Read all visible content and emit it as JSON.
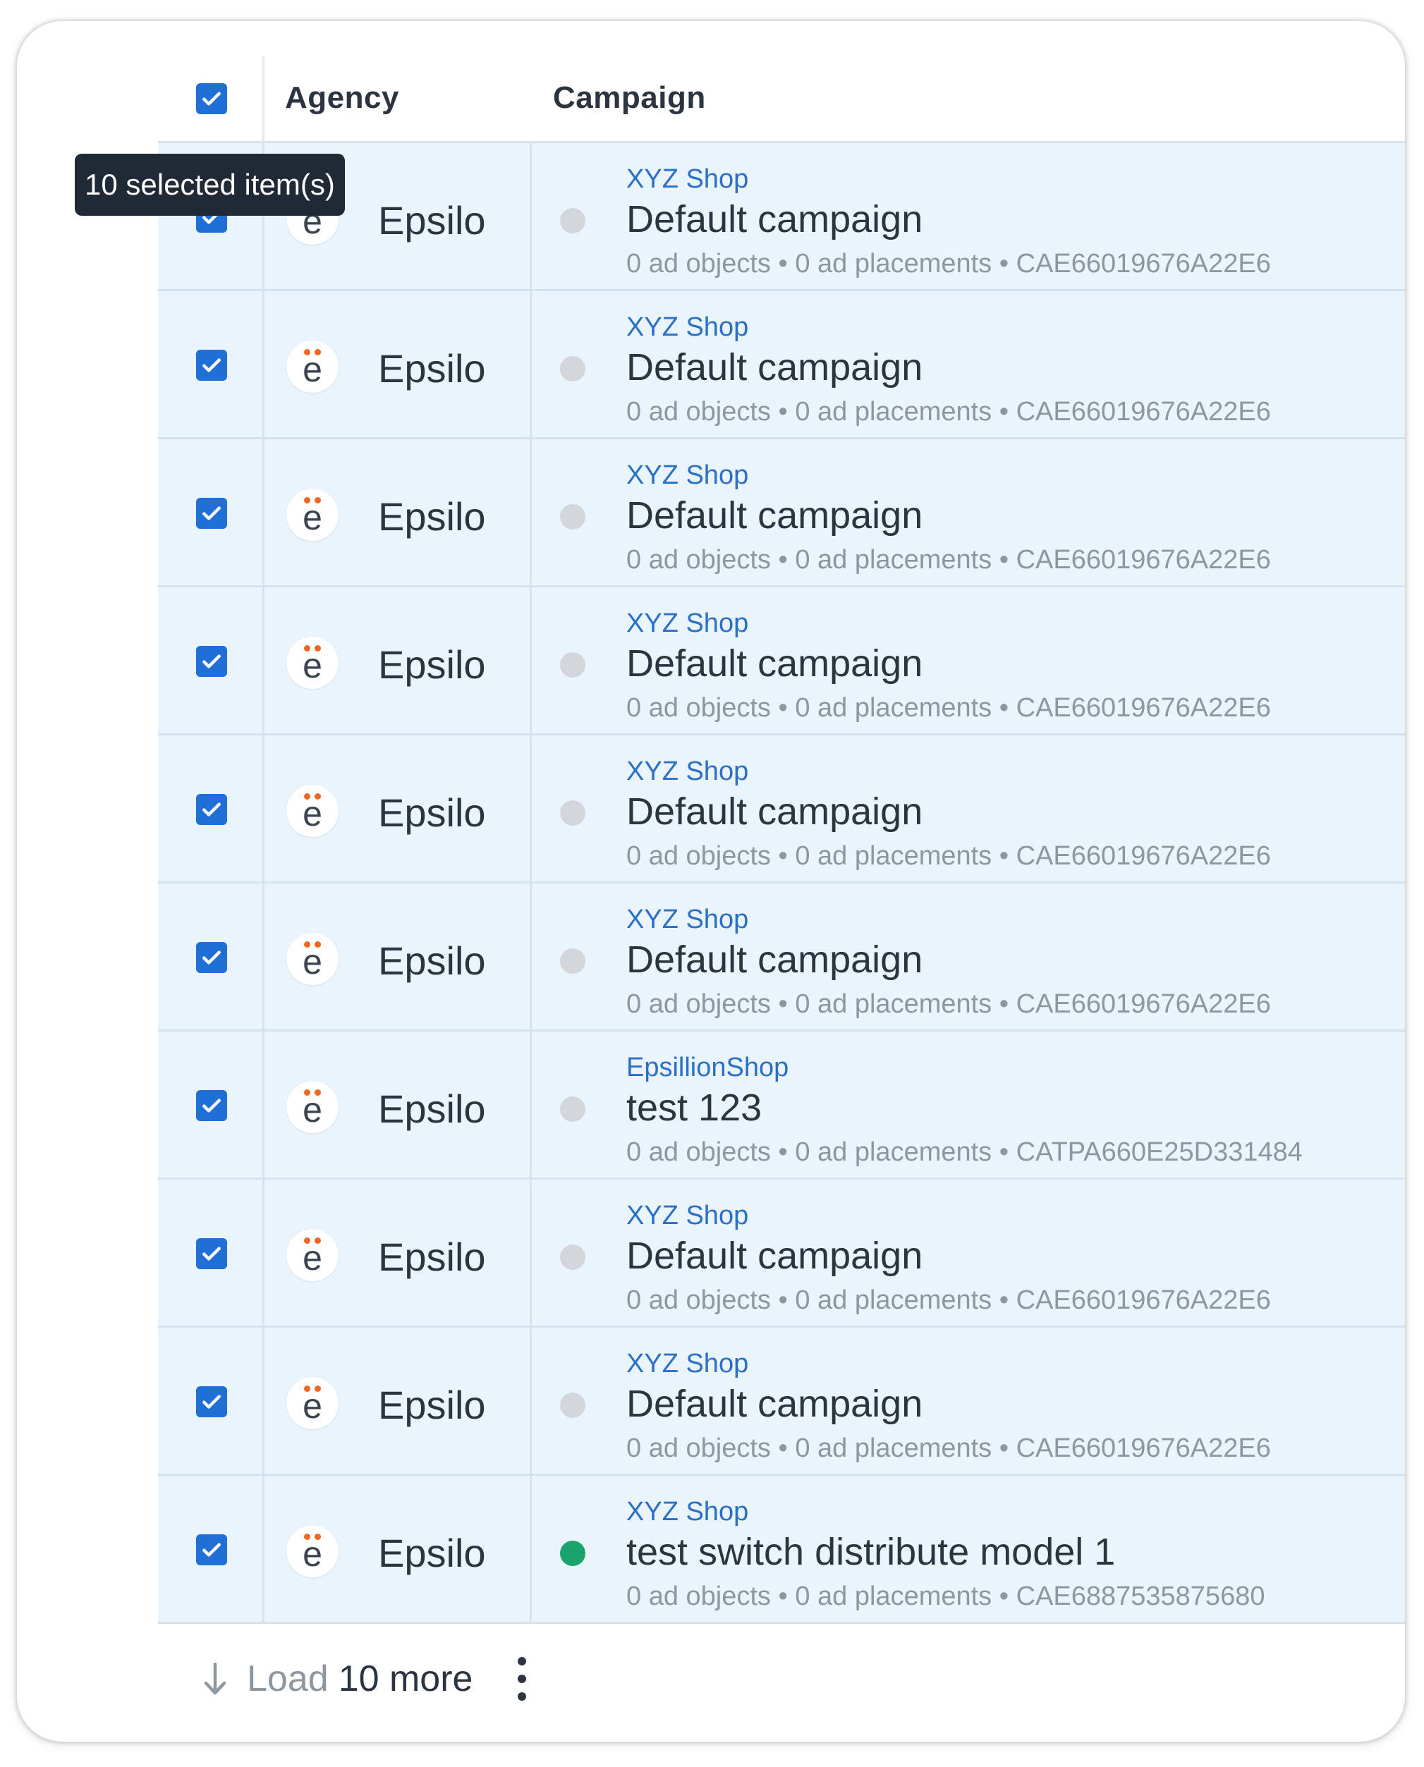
{
  "tooltip": "10 selected item(s)",
  "table": {
    "columns": [
      "Agency",
      "Campaign"
    ],
    "select_all_checked": true,
    "rows": [
      {
        "checked": true,
        "agency": "Epsilo",
        "agency_logo_icon": "epsilo-logo-icon",
        "shop": "XYZ Shop",
        "campaign": "Default campaign",
        "status": "inactive",
        "meta": "0 ad objects • 0 ad placements • CAE66019676A22E6"
      },
      {
        "checked": true,
        "agency": "Epsilo",
        "agency_logo_icon": "epsilo-logo-icon",
        "shop": "XYZ Shop",
        "campaign": "Default campaign",
        "status": "inactive",
        "meta": "0 ad objects • 0 ad placements • CAE66019676A22E6"
      },
      {
        "checked": true,
        "agency": "Epsilo",
        "agency_logo_icon": "epsilo-logo-icon",
        "shop": "XYZ Shop",
        "campaign": "Default campaign",
        "status": "inactive",
        "meta": "0 ad objects • 0 ad placements • CAE66019676A22E6"
      },
      {
        "checked": true,
        "agency": "Epsilo",
        "agency_logo_icon": "epsilo-logo-icon",
        "shop": "XYZ Shop",
        "campaign": "Default campaign",
        "status": "inactive",
        "meta": "0 ad objects • 0 ad placements • CAE66019676A22E6"
      },
      {
        "checked": true,
        "agency": "Epsilo",
        "agency_logo_icon": "epsilo-logo-icon",
        "shop": "XYZ Shop",
        "campaign": "Default campaign",
        "status": "inactive",
        "meta": "0 ad objects • 0 ad placements • CAE66019676A22E6"
      },
      {
        "checked": true,
        "agency": "Epsilo",
        "agency_logo_icon": "epsilo-logo-icon",
        "shop": "XYZ Shop",
        "campaign": "Default campaign",
        "status": "inactive",
        "meta": "0 ad objects • 0 ad placements • CAE66019676A22E6"
      },
      {
        "checked": true,
        "agency": "Epsilo",
        "agency_logo_icon": "epsilo-logo-icon",
        "shop": "EpsillionShop",
        "campaign": "test 123",
        "status": "inactive",
        "meta": "0 ad objects • 0 ad placements • CATPA660E25D331484"
      },
      {
        "checked": true,
        "agency": "Epsilo",
        "agency_logo_icon": "epsilo-logo-icon",
        "shop": "XYZ Shop",
        "campaign": "Default campaign",
        "status": "inactive",
        "meta": "0 ad objects • 0 ad placements • CAE66019676A22E6"
      },
      {
        "checked": true,
        "agency": "Epsilo",
        "agency_logo_icon": "epsilo-logo-icon",
        "shop": "XYZ Shop",
        "campaign": "Default campaign",
        "status": "inactive",
        "meta": "0 ad objects • 0 ad placements • CAE66019676A22E6"
      },
      {
        "checked": true,
        "agency": "Epsilo",
        "agency_logo_icon": "epsilo-logo-icon",
        "shop": "XYZ Shop",
        "campaign": "test switch distribute model 1",
        "status": "active",
        "meta": "0 ad objects • 0 ad placements • CAE6887535875680"
      }
    ]
  },
  "footer": {
    "load_label": "Load",
    "load_count": "10 more",
    "arrow_icon": "arrow-down-icon",
    "more_icon": "more-vertical-icon"
  },
  "colors": {
    "accent": "#1f6fd6",
    "shop_link": "#2a6fc9",
    "row_selected_bg": "#eaf4fd",
    "status_inactive": "#d3d6db",
    "status_active": "#1aa36b",
    "tooltip_bg": "#202a36",
    "logo_dots": "#f0671f"
  }
}
